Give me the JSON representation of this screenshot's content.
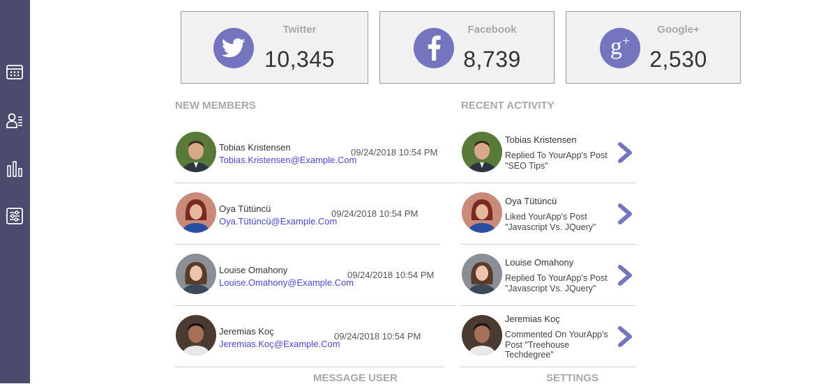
{
  "sidebar": {
    "items": [
      {
        "icon": "calendar-icon"
      },
      {
        "icon": "members-icon"
      },
      {
        "icon": "bar-chart-icon"
      },
      {
        "icon": "settings-sliders-icon"
      }
    ],
    "color": "#4b4b6e"
  },
  "social": [
    {
      "name": "Twitter",
      "count": "10,345",
      "icon": "twitter-icon"
    },
    {
      "name": "Facebook",
      "count": "8,739",
      "icon": "facebook-icon"
    },
    {
      "name": "Google+",
      "count": "2,530",
      "icon": "google-plus-icon"
    }
  ],
  "accent": "#7474bf",
  "new_members": {
    "title": "NEW MEMBERS",
    "members": [
      {
        "name": "Tobias Kristensen",
        "email": "Tobias.Kristensen@Example.Com",
        "date": "09/24/2018 10:54 PM"
      },
      {
        "name": "Oya Tütüncü",
        "email": "Oya.Tütüncü@Example.Com",
        "date": "09/24/2018 10:54 PM"
      },
      {
        "name": "Louise Omahony",
        "email": "Louise.Omahony@Example.Com",
        "date": "09/24/2018 10:54 PM"
      },
      {
        "name": "Jeremias Koç",
        "email": "Jeremias.Koç@Example.Com",
        "date": "09/24/2018 10:54 PM"
      }
    ]
  },
  "recent_activity": {
    "title": "RECENT ACTIVITY",
    "items": [
      {
        "name": "Tobias Kristensen",
        "text": "Replied To YourApp's Post \"SEO Tips\""
      },
      {
        "name": "Oya Tütüncü",
        "text": "Liked YourApp's Post \"Javascript Vs. JQuery\""
      },
      {
        "name": "Louise Omahony",
        "text": "Replied To YourApp's Post \"Javascript Vs. JQuery\""
      },
      {
        "name": "Jeremias Koç",
        "text": "Commented On YourApp's Post \"Treehouse Techdegree\""
      }
    ]
  },
  "footer": {
    "message_user": "MESSAGE USER",
    "settings": "SETTINGS"
  }
}
